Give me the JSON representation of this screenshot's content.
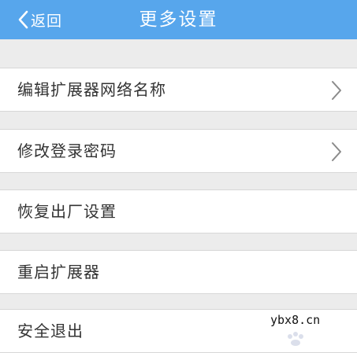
{
  "header": {
    "back_label": "返回",
    "title": "更多设置",
    "background": "#57a6ec"
  },
  "menu": {
    "items": [
      {
        "label": "编辑扩展器网络名称",
        "has_chevron": true
      },
      {
        "label": "修改登录密码",
        "has_chevron": true
      },
      {
        "label": "恢复出厂设置",
        "has_chevron": false
      },
      {
        "label": "重启扩展器",
        "has_chevron": false
      },
      {
        "label": "安全退出",
        "has_chevron": false
      }
    ]
  },
  "watermark": {
    "text": "ybx8.cn"
  },
  "icons": {
    "back": "chevron-left-icon",
    "row_arrow": "chevron-right-icon"
  }
}
